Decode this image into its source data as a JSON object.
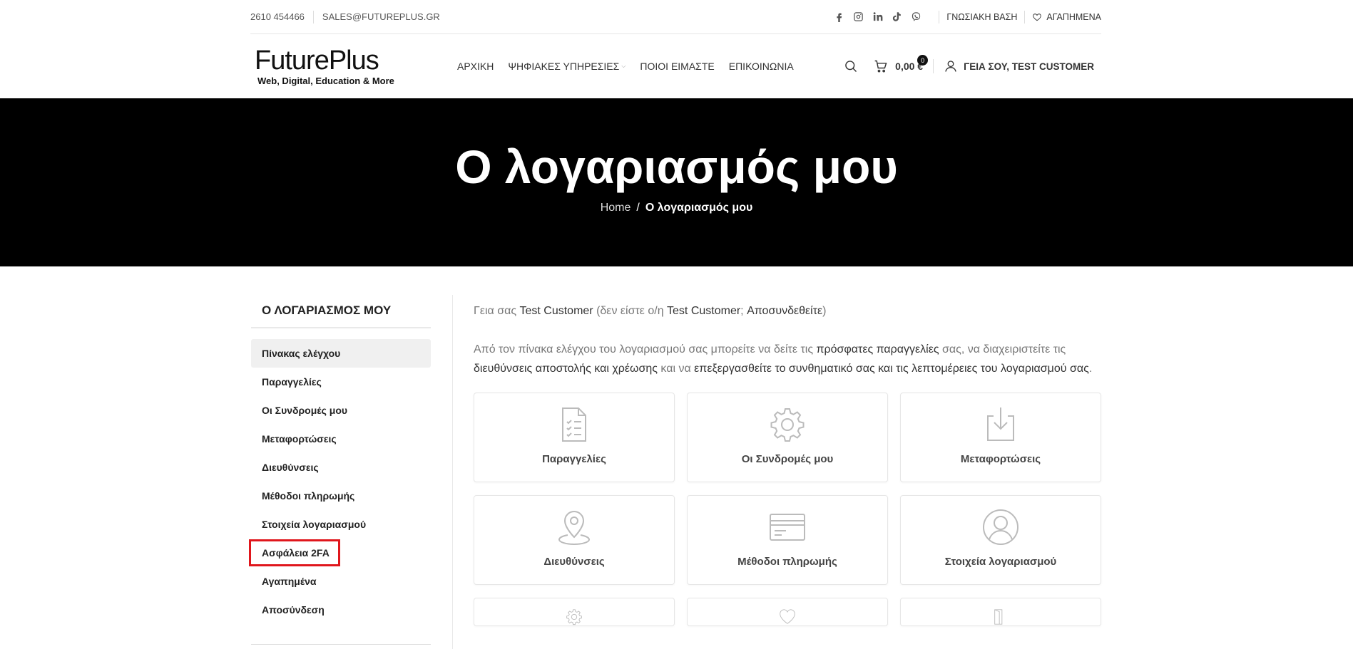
{
  "topbar": {
    "phone": "2610 454466",
    "email": "SALES@FUTUREPLUS.GR",
    "socials": [
      "facebook-icon",
      "instagram-icon",
      "linkedin-icon",
      "tiktok-icon",
      "viber-icon"
    ],
    "knowledge_base": "ΓΝΩΣΙΑΚΗ ΒΑΣΗ",
    "wishlist": "ΑΓΑΠΗΜΕΝΑ"
  },
  "header": {
    "logo_brand": "FuturePlus",
    "logo_tagline": "Web, Digital, Education & More",
    "nav": [
      {
        "label": "ΑΡΧΙΚΗ"
      },
      {
        "label": "ΨΗΦΙΑΚΕΣ ΥΠΗΡΕΣΙΕΣ",
        "has_dropdown": true
      },
      {
        "label": "ΠΟΙΟΙ ΕΙΜΑΣΤΕ"
      },
      {
        "label": "ΕΠΙΚΟΙΝΩΝΙΑ"
      }
    ],
    "cart_count": "0",
    "cart_total": "0,00 €",
    "account_label": "ΓΕΙΑ ΣΟΥ, TEST CUSTOMER"
  },
  "hero": {
    "title": "Ο λογαριασμός μου",
    "breadcrumb_home": "Home",
    "breadcrumb_sep": "/",
    "breadcrumb_current": "Ο λογαριασμός μου"
  },
  "sidebar": {
    "title": "Ο ΛΟΓΑΡΙΑΣΜΟΣ ΜΟΥ",
    "items": [
      {
        "label": "Πίνακας ελέγχου",
        "active": true
      },
      {
        "label": "Παραγγελίες"
      },
      {
        "label": "Οι Συνδρομές μου"
      },
      {
        "label": "Μεταφορτώσεις"
      },
      {
        "label": "Διευθύνσεις"
      },
      {
        "label": "Μέθοδοι πληρωμής"
      },
      {
        "label": "Στοιχεία λογαριασμού"
      },
      {
        "label": "Ασφάλεια 2FA",
        "highlighted": true
      },
      {
        "label": "Αγαπημένα"
      },
      {
        "label": "Αποσύνδεση"
      }
    ]
  },
  "content": {
    "greeting_prefix": "Γεια σας ",
    "greeting_name": "Test Customer",
    "greeting_mid": " (δεν είστε ο/η ",
    "greeting_name2": "Test Customer",
    "greeting_q": "; ",
    "logout_link": "Αποσυνδεθείτε",
    "greeting_end": ")",
    "intro_1": "Από τον πίνακα ελέγχου του λογαριασμού σας μπορείτε να δείτε τις ",
    "intro_link_orders": "πρόσφατες παραγγελίες",
    "intro_2": " σας, να διαχειριστείτε τις ",
    "intro_link_addresses": "διευθύνσεις αποστολής και χρέωσης",
    "intro_3": " και να ",
    "intro_link_account": "επεξεργασθείτε το συνθηματικό σας και τις λεπτομέρειες του λογαριασμού σας",
    "intro_4": ".",
    "tiles": [
      {
        "label": "Παραγγελίες",
        "icon": "orders-document-icon"
      },
      {
        "label": "Οι Συνδρομές μου",
        "icon": "gear-icon"
      },
      {
        "label": "Μεταφορτώσεις",
        "icon": "download-icon"
      },
      {
        "label": "Διευθύνσεις",
        "icon": "map-pin-icon"
      },
      {
        "label": "Μέθοδοι πληρωμής",
        "icon": "credit-card-icon"
      },
      {
        "label": "Στοιχεία λογαριασμού",
        "icon": "user-circle-icon"
      }
    ],
    "partial_tiles": [
      {
        "icon": "gear-icon"
      },
      {
        "icon": "heart-icon"
      },
      {
        "icon": "logout-icon"
      }
    ]
  }
}
